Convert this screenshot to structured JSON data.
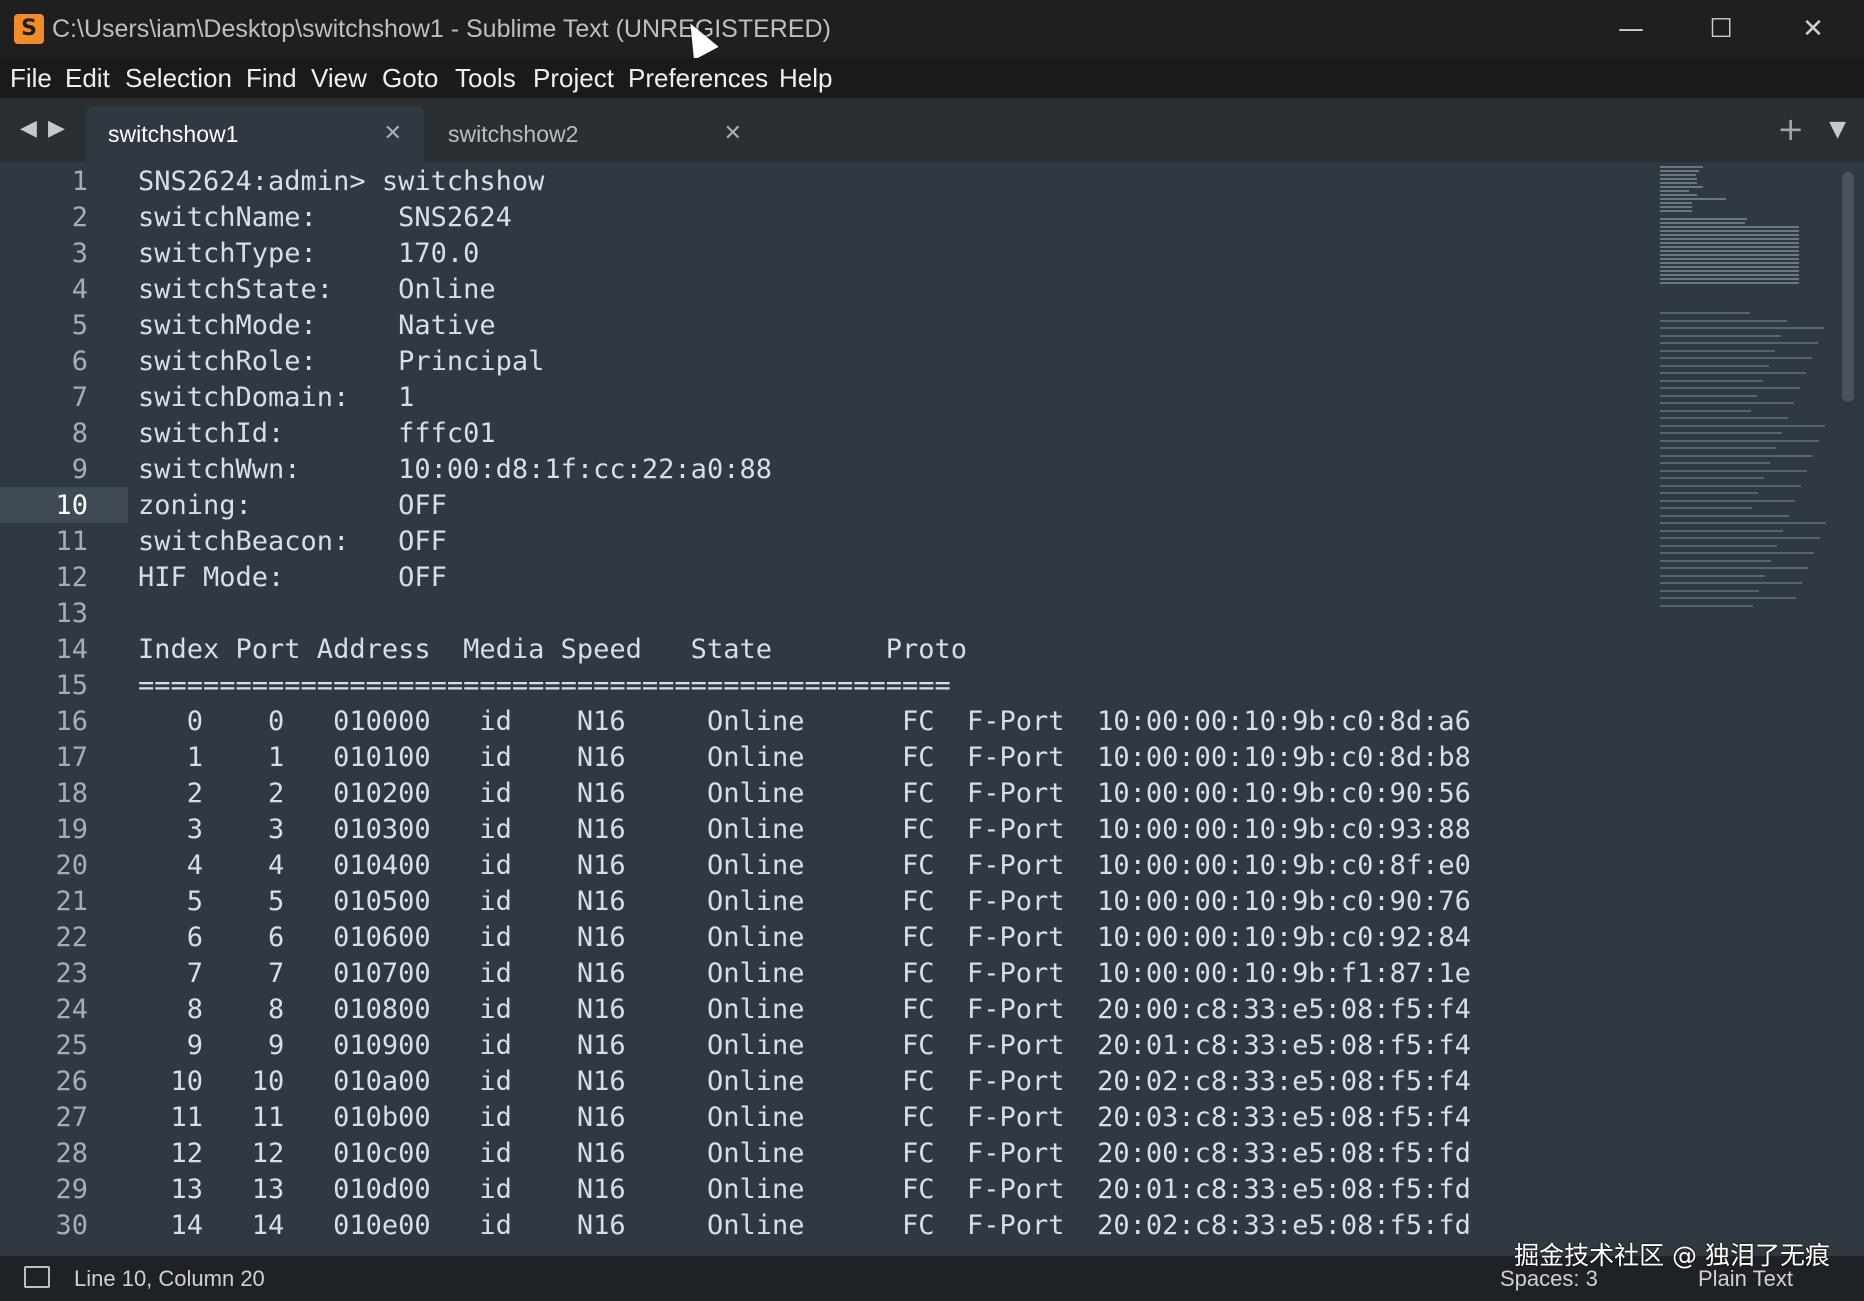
{
  "window": {
    "title": "C:\\Users\\iam\\Desktop\\switchshow1 - Sublime Text (UNREGISTERED)",
    "icon": "sublime-text-icon",
    "controls": {
      "minimize": "—",
      "maximize": "☐",
      "close": "✕"
    }
  },
  "menu": [
    "File",
    "Edit",
    "Selection",
    "Find",
    "View",
    "Goto",
    "Tools",
    "Project",
    "Preferences",
    "Help"
  ],
  "tabs": [
    {
      "label": "switchshow1",
      "active": true,
      "close": "✕"
    },
    {
      "label": "switchshow2",
      "active": false,
      "close": "✕"
    }
  ],
  "tabbar": {
    "nav_left": "◀",
    "nav_right": "▶",
    "add": "+",
    "menu": "▼"
  },
  "editor": {
    "current_line": 10,
    "lines": [
      "SNS2624:admin> switchshow",
      "switchName:     SNS2624",
      "switchType:     170.0",
      "switchState:    Online",
      "switchMode:     Native",
      "switchRole:     Principal",
      "switchDomain:   1",
      "switchId:       fffc01",
      "switchWwn:      10:00:d8:1f:cc:22:a0:88",
      "zoning:         OFF",
      "switchBeacon:   OFF",
      "HIF Mode:       OFF",
      "",
      "Index Port Address  Media Speed   State       Proto",
      "==================================================",
      "   0    0   010000   id    N16     Online      FC  F-Port  10:00:00:10:9b:c0:8d:a6",
      "   1    1   010100   id    N16     Online      FC  F-Port  10:00:00:10:9b:c0:8d:b8",
      "   2    2   010200   id    N16     Online      FC  F-Port  10:00:00:10:9b:c0:90:56",
      "   3    3   010300   id    N16     Online      FC  F-Port  10:00:00:10:9b:c0:93:88",
      "   4    4   010400   id    N16     Online      FC  F-Port  10:00:00:10:9b:c0:8f:e0",
      "   5    5   010500   id    N16     Online      FC  F-Port  10:00:00:10:9b:c0:90:76",
      "   6    6   010600   id    N16     Online      FC  F-Port  10:00:00:10:9b:c0:92:84",
      "   7    7   010700   id    N16     Online      FC  F-Port  10:00:00:10:9b:f1:87:1e",
      "   8    8   010800   id    N16     Online      FC  F-Port  20:00:c8:33:e5:08:f5:f4",
      "   9    9   010900   id    N16     Online      FC  F-Port  20:01:c8:33:e5:08:f5:f4",
      "  10   10   010a00   id    N16     Online      FC  F-Port  20:02:c8:33:e5:08:f5:f4",
      "  11   11   010b00   id    N16     Online      FC  F-Port  20:03:c8:33:e5:08:f5:f4",
      "  12   12   010c00   id    N16     Online      FC  F-Port  20:00:c8:33:e5:08:f5:fd",
      "  13   13   010d00   id    N16     Online      FC  F-Port  20:01:c8:33:e5:08:f5:fd",
      "  14   14   010e00   id    N16     Online      FC  F-Port  20:02:c8:33:e5:08:f5:fd"
    ]
  },
  "statusbar": {
    "position": "Line 10, Column 20",
    "spaces": "Spaces: 3",
    "syntax": "Plain Text"
  },
  "watermark": "掘金技术社区 @ 独泪了无痕"
}
